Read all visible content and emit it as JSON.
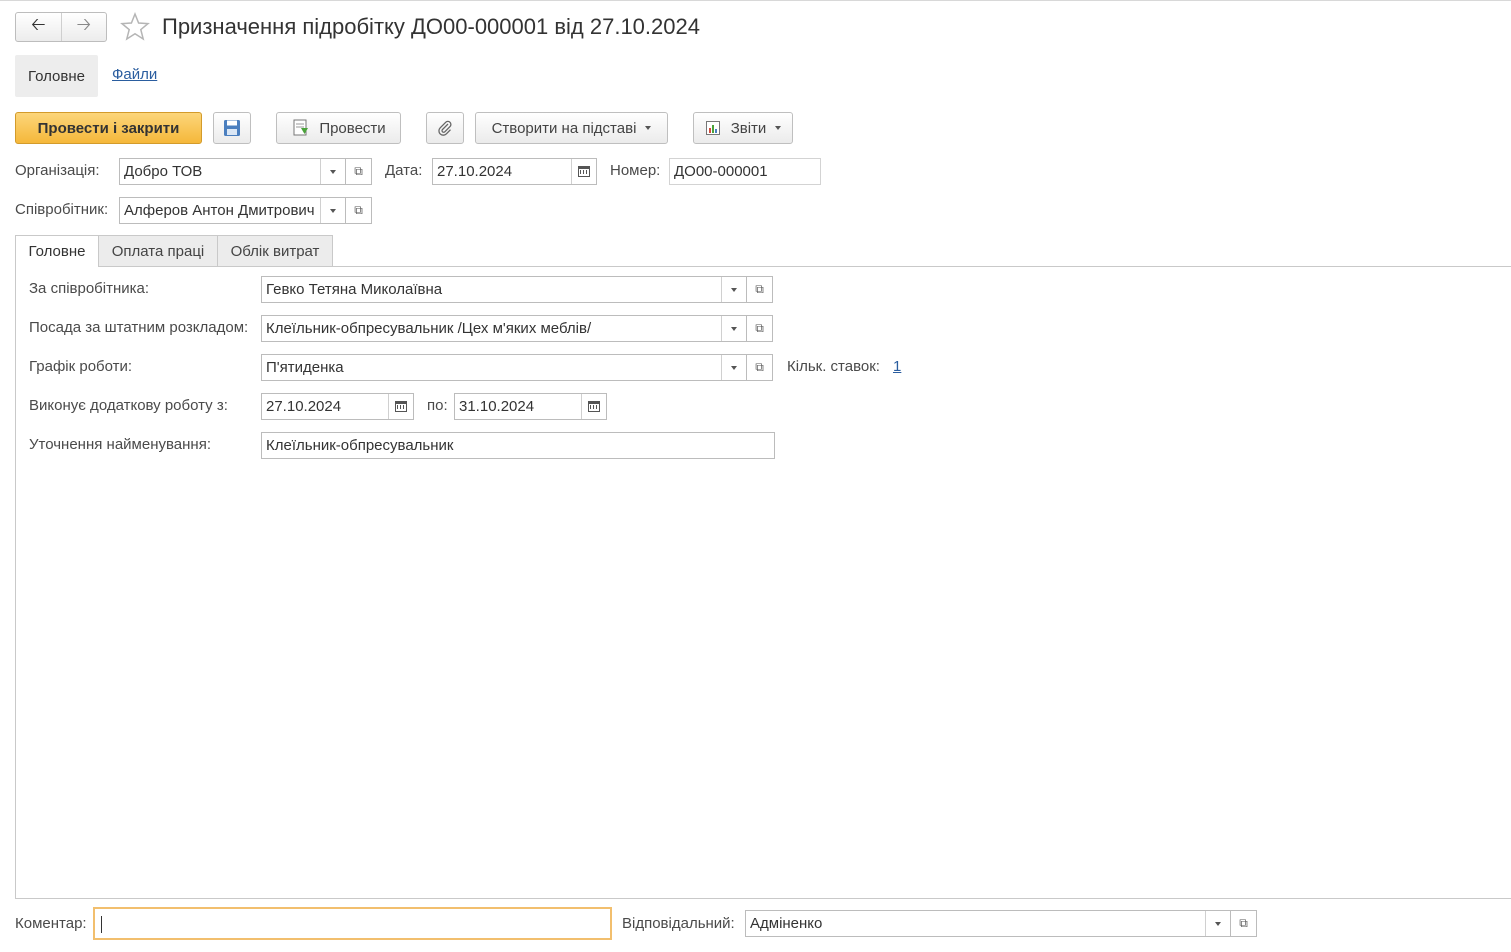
{
  "window": {
    "title": "Призначення підробітку ДО00-000001 від 27.10.2024"
  },
  "sections": {
    "main_label": "Головне",
    "files_label": "Файли"
  },
  "toolbar": {
    "post_close_label": "Провести і закрити",
    "post_label": "Провести",
    "create_basis_label": "Створити на підставі",
    "reports_label": "Звіти"
  },
  "header": {
    "organization_label": "Організація:",
    "organization_value": "Добро ТОВ",
    "date_label": "Дата:",
    "date_value": "27.10.2024",
    "number_label": "Номер:",
    "number_value": "ДО00-000001",
    "employee_label": "Співробітник:",
    "employee_value": "Алферов Антон Дмитрович"
  },
  "tabs": [
    {
      "label": "Головне",
      "active": true
    },
    {
      "label": "Оплата праці",
      "active": false
    },
    {
      "label": "Облік витрат",
      "active": false
    }
  ],
  "main_tab": {
    "for_employee_label": "За співробітника:",
    "for_employee_value": "Гевко Тетяна Миколаївна",
    "position_label": "Посада за штатним розкладом:",
    "position_value": "Клеїльник-обпресувальник /Цех м'яких меблів/",
    "schedule_label": "Графік роботи:",
    "schedule_value": "П'ятиденка",
    "rate_count_label": "Кільк. ставок:",
    "rate_count_value": "1",
    "extra_work_from_label": "Виконує додаткову роботу з:",
    "extra_work_from_value": "27.10.2024",
    "extra_work_to_label": "по:",
    "extra_work_to_value": "31.10.2024",
    "name_clarification_label": "Уточнення найменування:",
    "name_clarification_value": "Клеїльник-обпресувальник"
  },
  "footer": {
    "comment_label": "Коментар:",
    "comment_value": "",
    "responsible_label": "Відповідальний:",
    "responsible_value": "Адміненко"
  },
  "colors": {
    "primary_button": "#f5b83a",
    "link": "#2a5d9f",
    "focus_border": "#f2bf6e"
  },
  "icons": {
    "back": "arrow-left-icon",
    "forward": "arrow-right-icon",
    "favorite": "star-icon",
    "save": "floppy-disk-icon",
    "post": "post-document-icon",
    "attach": "paperclip-icon",
    "reports": "report-chart-icon",
    "calendar": "calendar-icon",
    "open": "open-form-icon",
    "dropdown": "chevron-down-icon"
  }
}
